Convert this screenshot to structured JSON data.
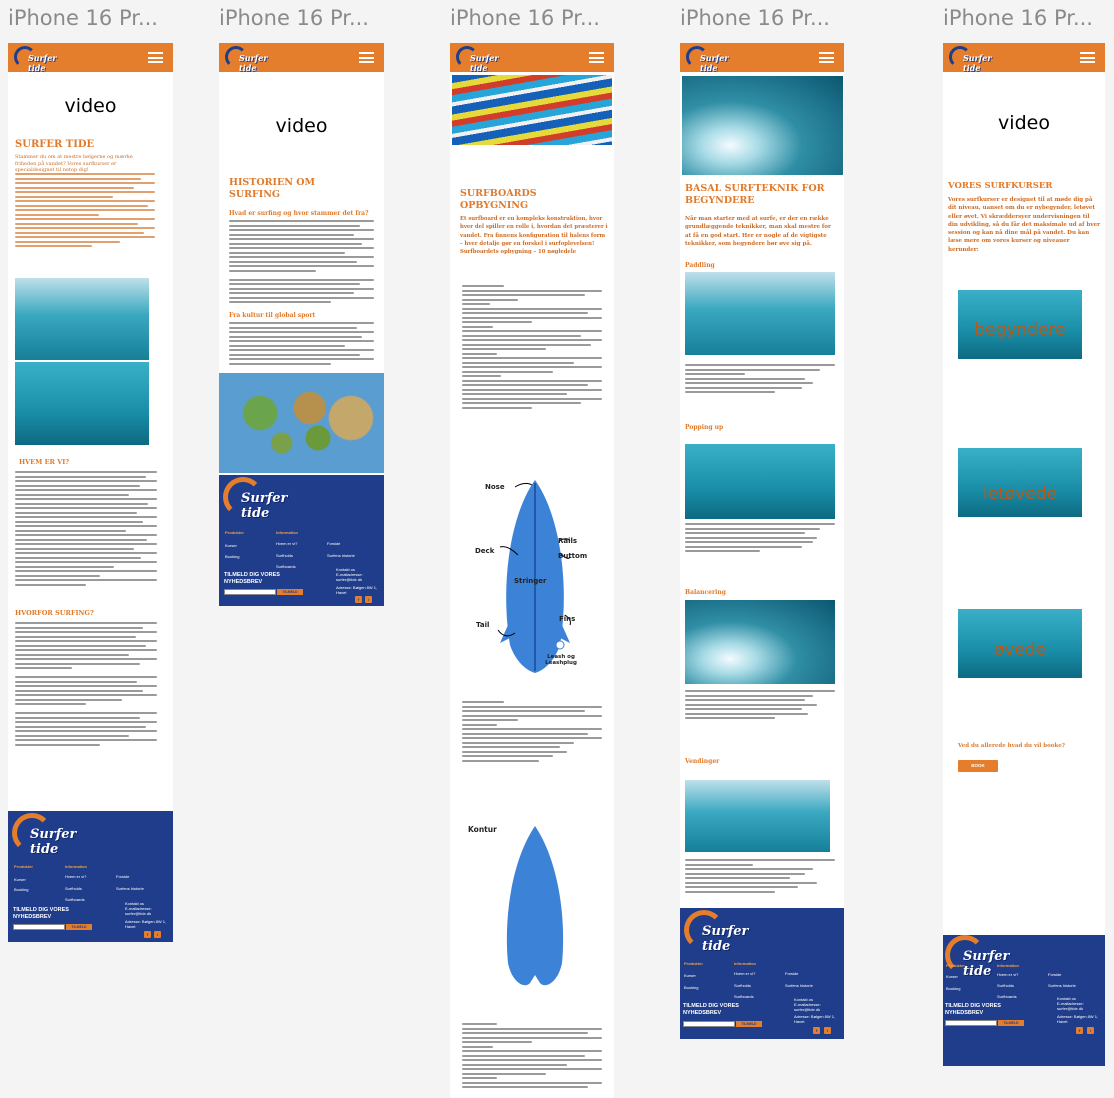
{
  "frames": [
    {
      "title": "iPhone 16 Pr..."
    },
    {
      "title": "iPhone 16 Pr..."
    },
    {
      "title": "iPhone 16 Pr..."
    },
    {
      "title": "iPhone 16 Pr..."
    },
    {
      "title": "iPhone 16 Pr..."
    }
  ],
  "brand": {
    "logo_text": "Surfer tide",
    "accent": "#e57e2c",
    "footer_bg": "#1f3d8b"
  },
  "frame1": {
    "video": "video",
    "heading": "SURFER TIDE",
    "intro": "Stammer du om at mestre bølgerne og mærke friheden på vandet? Vores surfkurser er specialdesignet til netop dig!",
    "who_heading": "HVEM ER VI?",
    "why_heading": "HVORFOR SURFING?"
  },
  "frame2": {
    "video": "video",
    "heading": "HISTORIEN OM SURFING",
    "subheading": "Hvad er surfing og hvor stammer det fra?",
    "culture_heading": "Fra kultur til global sport"
  },
  "frame3": {
    "heading": "SURFBOARDS OPBYGNING",
    "intro": "Et surfboard er en kompleks konstruktion, hvor hver del spiller en rolle i, hvordan det præsterer i vandet. Fra finnens konfiguration til halens form – hver detalje gør en forskel i surfoplevelsen! Surfboardets opbygning – 10 nøgledele",
    "diagram_labels": [
      "Nose",
      "Rails",
      "Deck",
      "Buttom",
      "Stringer",
      "Fins",
      "Tail",
      "Leash og Leashplug"
    ],
    "kontur_label": "Kontur"
  },
  "frame4": {
    "heading": "BASAL SURFTEKNIK FOR BEGYNDERE",
    "intro": "Når man starter med at surfe, er der en række grundlæggende teknikker, man skal mestre for at få en god start. Her er nogle af de vigtigste teknikker, som begyndere bør øve sig på.",
    "sections": [
      "Paddling",
      "Popping up",
      "Balancering",
      "Vendinger"
    ]
  },
  "frame5": {
    "video": "video",
    "heading": "VORES SURFKURSER",
    "intro": "Vores surfkurser er designet til at møde dig på dit niveau, uanset om du er nybegynder, letøvet eller øvet. Vi skræddersyer undervisningen til din udvikling, så du får det maksimale ud af hver session og kan nå dine mål på vandet. Du kan læse mere om vores kurser og niveauer herunder:",
    "levels": [
      "begyndere",
      "letøvede",
      "øvede"
    ],
    "question": "Ved du allerede hvad du vil booke?",
    "book_button": "BOOK"
  },
  "footer": {
    "col1_head": "Produkter",
    "col1": [
      "Kurser",
      "Booking"
    ],
    "col2_head": "Information",
    "col2": [
      "Hvem er vi?",
      "Surfholds",
      "Surfboards"
    ],
    "col3": [
      "Forside",
      "Surfens historie"
    ],
    "contact": [
      "Kontakt os",
      "E-mailadresse:",
      "surfer@tide.dk"
    ],
    "address": [
      "Adresse: Bølgen 8W 1,",
      "Havet"
    ],
    "newsletter": "TILMELD DIG VORES NYHEDSBREV",
    "subscribe": "TILMELD",
    "social": [
      "f",
      "i"
    ]
  }
}
